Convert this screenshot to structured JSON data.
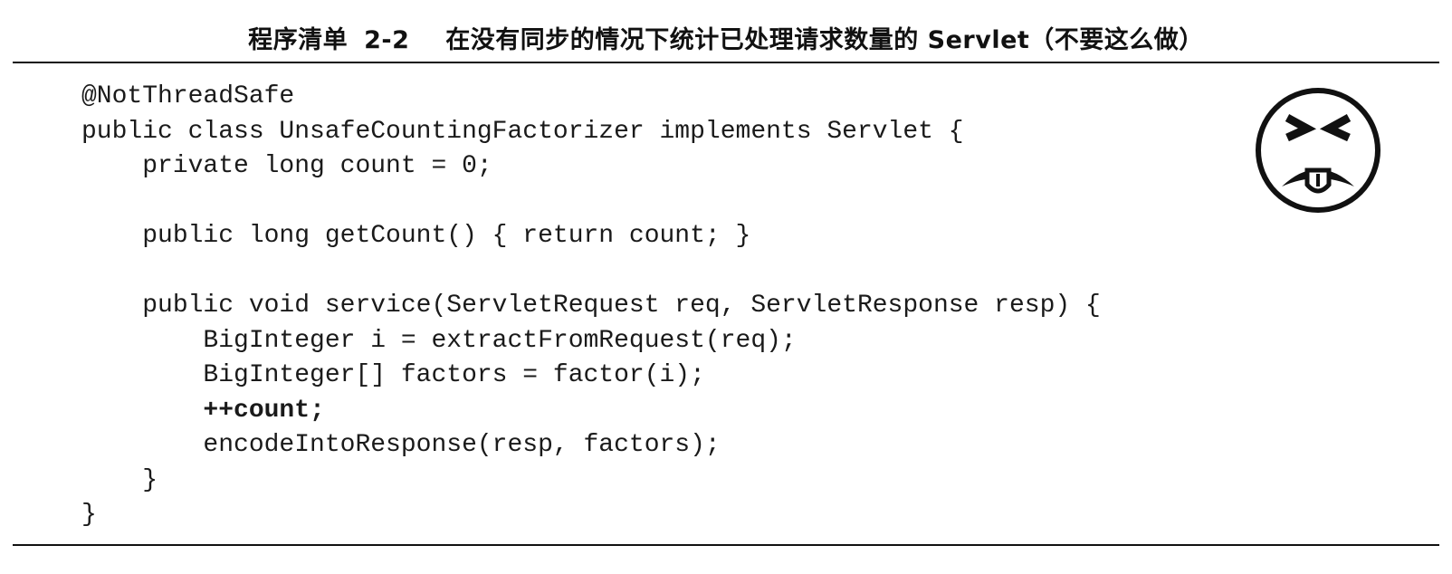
{
  "listing": {
    "label": "程序清单",
    "number": "2-2",
    "title": "在没有同步的情况下统计已处理请求数量的 Servlet（不要这么做）"
  },
  "code": {
    "lines": [
      "@NotThreadSafe",
      "public class UnsafeCountingFactorizer implements Servlet {",
      "    private long count = 0;",
      "",
      "    public long getCount() { return count; }",
      "",
      "    public void service(ServletRequest req, ServletResponse resp) {",
      "        BigInteger i = extractFromRequest(req);",
      "        BigInteger[] factors = factor(i);",
      "        ++count;",
      "        encodeIntoResponse(resp, factors);",
      "    }",
      "}"
    ],
    "highlighted_line": "        ++count;"
  },
  "icon": {
    "name": "bad-practice-face-icon"
  }
}
